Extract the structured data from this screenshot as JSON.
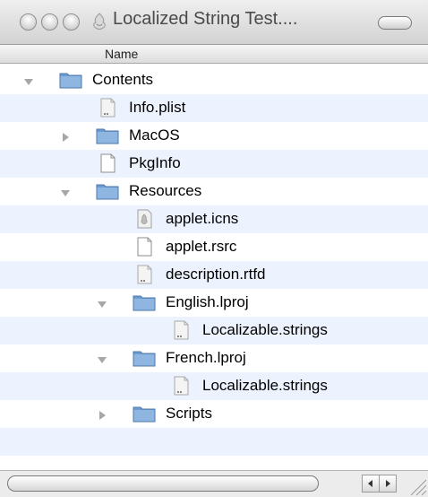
{
  "window": {
    "title": "Localized String Test...."
  },
  "columns": {
    "name": "Name"
  },
  "items": [
    {
      "label": "Contents",
      "kind": "folder",
      "level": 0,
      "disclosure": "expanded"
    },
    {
      "label": "Info.plist",
      "kind": "document",
      "level": 1,
      "disclosure": "none"
    },
    {
      "label": "MacOS",
      "kind": "folder",
      "level": 1,
      "disclosure": "collapsed"
    },
    {
      "label": "PkgInfo",
      "kind": "blank",
      "level": 1,
      "disclosure": "none"
    },
    {
      "label": "Resources",
      "kind": "folder",
      "level": 1,
      "disclosure": "expanded"
    },
    {
      "label": "applet.icns",
      "kind": "icns",
      "level": 2,
      "disclosure": "none"
    },
    {
      "label": "applet.rsrc",
      "kind": "blank",
      "level": 2,
      "disclosure": "none"
    },
    {
      "label": "description.rtfd",
      "kind": "document",
      "level": 2,
      "disclosure": "none"
    },
    {
      "label": "English.lproj",
      "kind": "folder",
      "level": 2,
      "disclosure": "expanded"
    },
    {
      "label": "Localizable.strings",
      "kind": "document",
      "level": 3,
      "disclosure": "none"
    },
    {
      "label": "French.lproj",
      "kind": "folder",
      "level": 2,
      "disclosure": "expanded"
    },
    {
      "label": "Localizable.strings",
      "kind": "document",
      "level": 3,
      "disclosure": "none"
    },
    {
      "label": "Scripts",
      "kind": "folder",
      "level": 2,
      "disclosure": "collapsed"
    }
  ],
  "colors": {
    "row_alt": "#edf3fe",
    "folder_blue": "#7fa9d6"
  }
}
